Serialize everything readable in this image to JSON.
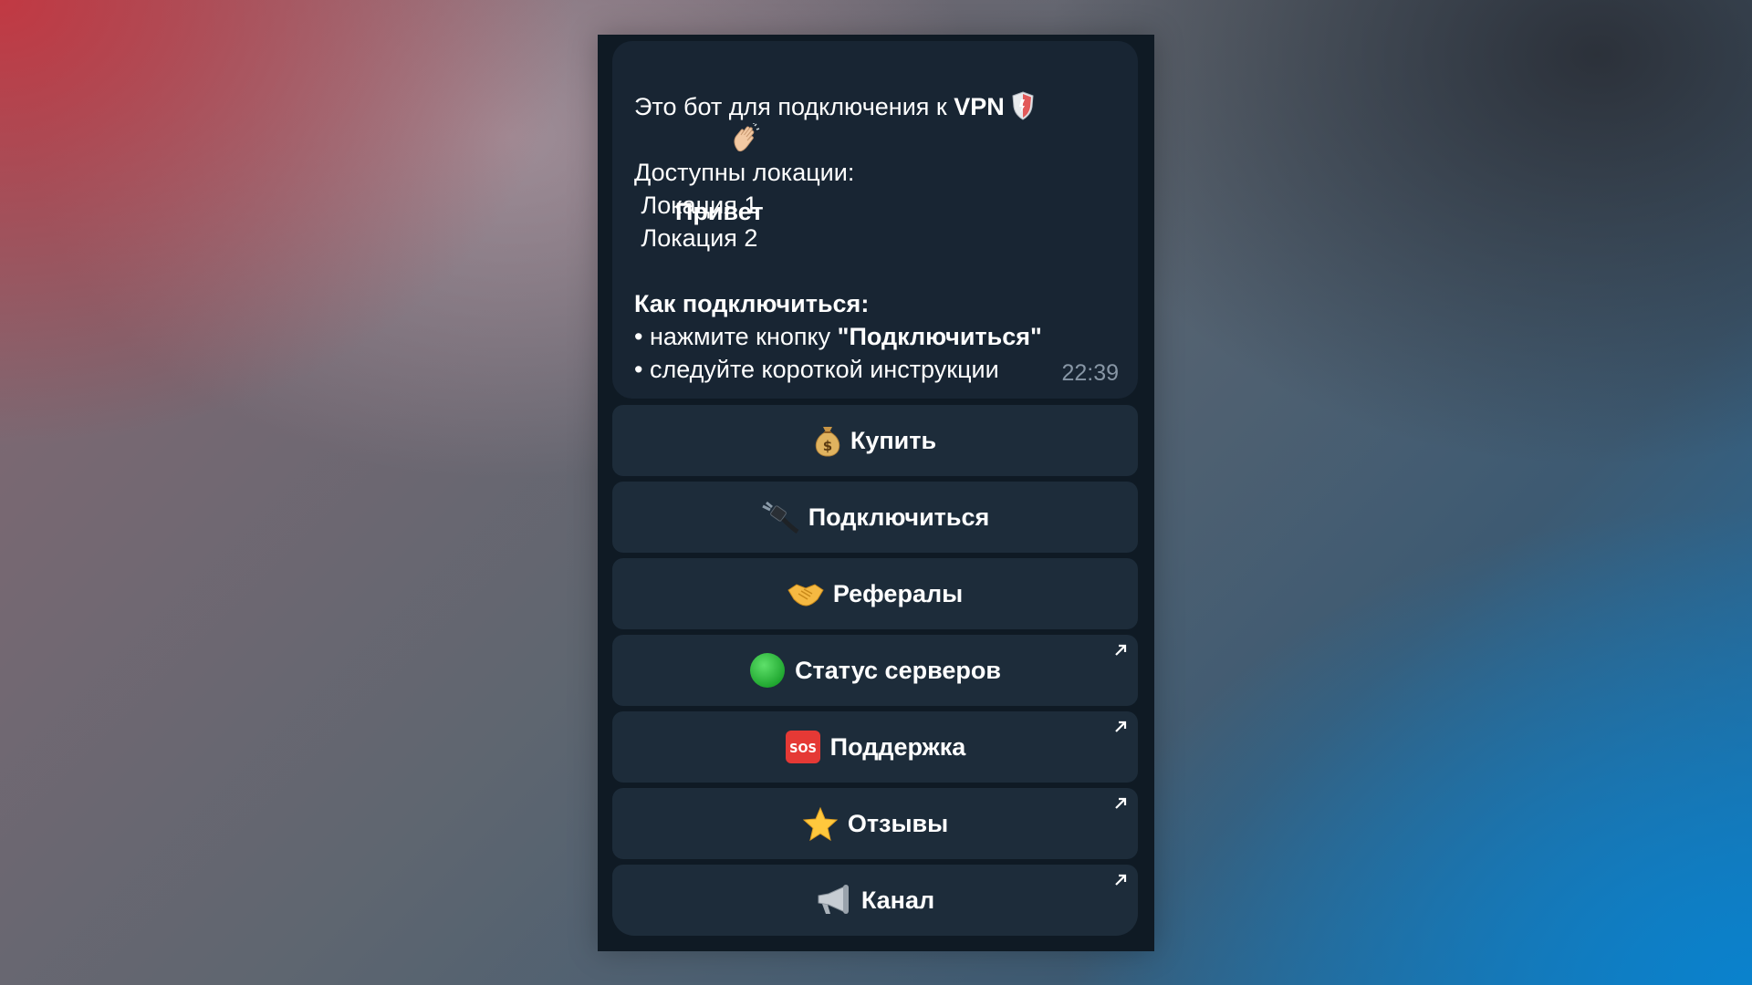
{
  "message": {
    "greeting": "Привет",
    "intro": "Это бот для подключения к ",
    "intro_bold": "VPN",
    "locations_title": "Доступны локации:",
    "locations": [
      " Локация 1",
      " Локация 2"
    ],
    "howto_title": "Как подключиться:",
    "step1_prefix": "• нажмите кнопку ",
    "step1_bold": "\"Подключиться\"",
    "step2": "• следуйте короткой инструкции",
    "time": "22:39"
  },
  "buttons": [
    {
      "label": "Купить",
      "icon": "money-bag-icon",
      "external": false
    },
    {
      "label": "Подключиться",
      "icon": "plug-icon",
      "external": false
    },
    {
      "label": "Рефералы",
      "icon": "handshake-icon",
      "external": false
    },
    {
      "label": "Статус серверов",
      "icon": "green-circle-icon",
      "external": true
    },
    {
      "label": "Поддержка",
      "icon": "sos-icon",
      "external": true
    },
    {
      "label": "Отзывы",
      "icon": "star-icon",
      "external": true
    },
    {
      "label": "Канал",
      "icon": "megaphone-icon",
      "external": true
    }
  ],
  "colors": {
    "panel_bg": "#0f1a24",
    "bubble_bg": "#182533",
    "button_bg": "#1d2c3a",
    "time_color": "#8796a5"
  }
}
